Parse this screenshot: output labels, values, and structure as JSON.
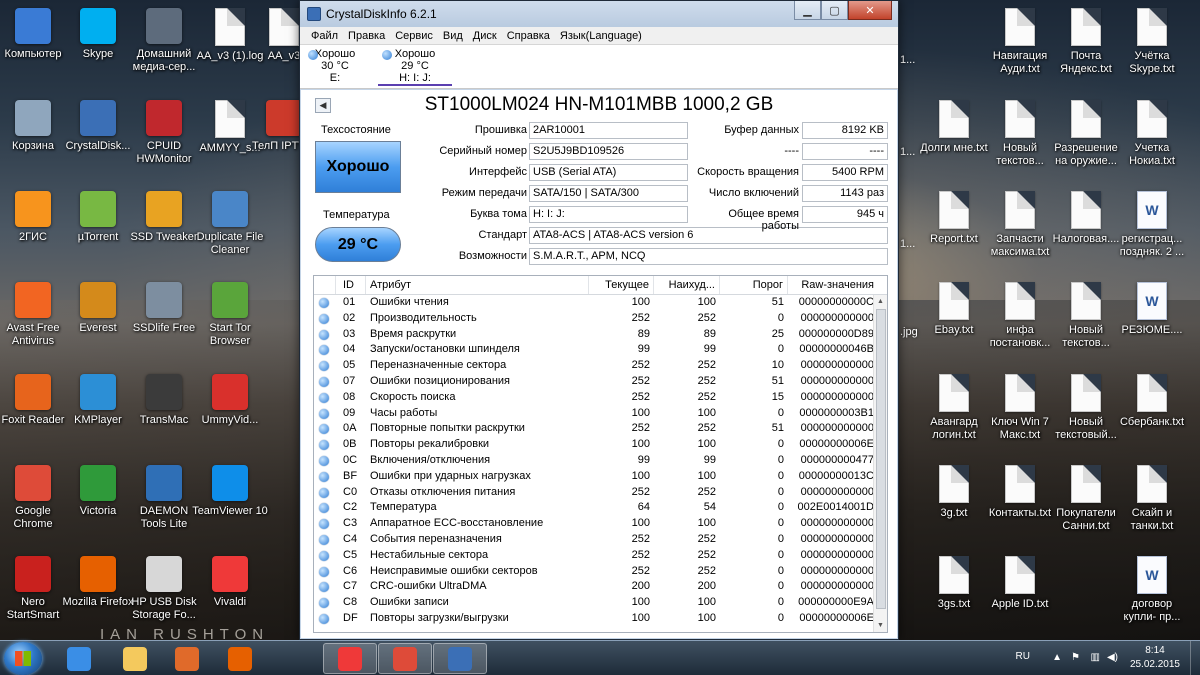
{
  "window": {
    "title": "CrystalDiskInfo 6.2.1",
    "menu": [
      "Файл",
      "Правка",
      "Сервис",
      "Вид",
      "Диск",
      "Справка",
      "Язык(Language)"
    ],
    "drives": [
      {
        "status": "Хорошо",
        "temp": "30 °C",
        "letters": "E:"
      },
      {
        "status": "Хорошо",
        "temp": "29 °C",
        "letters": "H: I: J:"
      }
    ],
    "model": "ST1000LM024 HN-M101MBB 1000,2 GB",
    "health_label": "Техсостояние",
    "health_value": "Хорошо",
    "temp_label": "Температура",
    "temp_value": "29 °C",
    "fields": {
      "firmware_label": "Прошивка",
      "firmware": "2AR10001",
      "serial_label": "Серийный номер",
      "serial": "S2U5J9BD109526",
      "interface_label": "Интерфейс",
      "interface": "USB (Serial ATA)",
      "transfer_label": "Режим передачи",
      "transfer": "SATA/150 | SATA/300",
      "letter_label": "Буква тома",
      "letter": "H: I: J:",
      "standard_label": "Стандарт",
      "standard": "ATA8-ACS | ATA8-ACS version 6",
      "features_label": "Возможности",
      "features": "S.M.A.R.T., APM, NCQ",
      "buffer_label": "Буфер данных",
      "buffer": "8192 KB",
      "blank_label": "----",
      "blank": "----",
      "rpm_label": "Скорость вращения",
      "rpm": "5400 RPM",
      "power_count_label": "Число включений",
      "power_count": "1143 раз",
      "power_hours_label": "Общее время работы",
      "power_hours": "945 ч"
    },
    "smart_headers": [
      "ID",
      "Атрибут",
      "Текущее",
      "Наихуд...",
      "Порог",
      "Raw-значения"
    ],
    "smart_rows": [
      [
        "01",
        "Ошибки чтения",
        "100",
        "100",
        "51",
        "00000000000C"
      ],
      [
        "02",
        "Производительность",
        "252",
        "252",
        "0",
        "000000000000"
      ],
      [
        "03",
        "Время раскрутки",
        "89",
        "89",
        "25",
        "000000000D89"
      ],
      [
        "04",
        "Запуски/остановки шпинделя",
        "99",
        "99",
        "0",
        "00000000046B"
      ],
      [
        "05",
        "Переназначенные сектора",
        "252",
        "252",
        "10",
        "000000000000"
      ],
      [
        "07",
        "Ошибки позиционирования",
        "252",
        "252",
        "51",
        "000000000000"
      ],
      [
        "08",
        "Скорость поиска",
        "252",
        "252",
        "15",
        "000000000000"
      ],
      [
        "09",
        "Часы работы",
        "100",
        "100",
        "0",
        "0000000003B1"
      ],
      [
        "0A",
        "Повторные попытки раскрутки",
        "252",
        "252",
        "51",
        "000000000000"
      ],
      [
        "0B",
        "Повторы рекалибровки",
        "100",
        "100",
        "0",
        "00000000006E"
      ],
      [
        "0C",
        "Включения/отключения",
        "99",
        "99",
        "0",
        "000000000477"
      ],
      [
        "BF",
        "Ошибки при ударных нагрузках",
        "100",
        "100",
        "0",
        "00000000013C"
      ],
      [
        "C0",
        "Отказы отключения питания",
        "252",
        "252",
        "0",
        "000000000000"
      ],
      [
        "C2",
        "Температура",
        "64",
        "54",
        "0",
        "002E0014001D"
      ],
      [
        "C3",
        "Аппаратное ECC-восстановление",
        "100",
        "100",
        "0",
        "000000000000"
      ],
      [
        "C4",
        "События переназначения",
        "252",
        "252",
        "0",
        "000000000000"
      ],
      [
        "C5",
        "Нестабильные сектора",
        "252",
        "252",
        "0",
        "000000000000"
      ],
      [
        "C6",
        "Неисправимые ошибки секторов",
        "252",
        "252",
        "0",
        "000000000000"
      ],
      [
        "C7",
        "CRC-ошибки UltraDMA",
        "200",
        "200",
        "0",
        "000000000000"
      ],
      [
        "C8",
        "Ошибки записи",
        "100",
        "100",
        "0",
        "000000000E9A"
      ],
      [
        "DF",
        "Повторы загрузки/выгрузки",
        "100",
        "100",
        "0",
        "00000000006E"
      ]
    ]
  },
  "desktop_icons_left": [
    {
      "label": "Компьютер",
      "icon": "computer-icon",
      "color": "#3a7bd5"
    },
    {
      "label": "Skype",
      "icon": "skype-icon",
      "color": "#00aff0"
    },
    {
      "label": "Домашний медиа-сер...",
      "icon": "media-server-icon",
      "color": "#5d6b7c"
    },
    {
      "label": "AA_v3 (1).log",
      "icon": "document-icon",
      "color": "#ffffff"
    },
    {
      "label": "AA_v3",
      "icon": "document-icon",
      "color": "#ffffff"
    },
    {
      "label": "Корзина",
      "icon": "recycle-bin-icon",
      "color": "#8fa6bd"
    },
    {
      "label": "CrystalDisk...",
      "icon": "crystaldisk-icon",
      "color": "#3b6fb6"
    },
    {
      "label": "CPUID HWMonitor",
      "icon": "hwmonitor-icon",
      "color": "#c0282d"
    },
    {
      "label": "AMMYY_s...",
      "icon": "document-icon",
      "color": "#ffffff"
    },
    {
      "label": "ТелП IPTV P",
      "icon": "iptv-icon",
      "color": "#cc3a2b"
    },
    {
      "label": "2ГИС",
      "icon": "2gis-icon",
      "color": "#f7941d"
    },
    {
      "label": "µTorrent",
      "icon": "utorrent-icon",
      "color": "#78b843"
    },
    {
      "label": "SSD Tweaker",
      "icon": "ssd-tweaker-icon",
      "color": "#e8a322"
    },
    {
      "label": "Duplicate File Cleaner",
      "icon": "duplicate-cleaner-icon",
      "color": "#4a86c8"
    },
    {
      "label": "Avast Free Antivirus",
      "icon": "avast-icon",
      "color": "#f26522"
    },
    {
      "label": "Everest",
      "icon": "everest-icon",
      "color": "#d48a1b"
    },
    {
      "label": "SSDlife Free",
      "icon": "ssdlife-icon",
      "color": "#7d8ea0"
    },
    {
      "label": "Start Tor Browser",
      "icon": "tor-icon",
      "color": "#5aa53b"
    },
    {
      "label": "Foxit Reader",
      "icon": "foxit-icon",
      "color": "#e7641c"
    },
    {
      "label": "KMPlayer",
      "icon": "kmplayer-icon",
      "color": "#2c8fd6"
    },
    {
      "label": "TransMac",
      "icon": "transmac-icon",
      "color": "#3b3b3b"
    },
    {
      "label": "UmmyVid...",
      "icon": "ummy-icon",
      "color": "#d9302c"
    },
    {
      "label": "Google Chrome",
      "icon": "chrome-icon",
      "color": "#de4b39"
    },
    {
      "label": "Victoria",
      "icon": "victoria-icon",
      "color": "#2f9a3a"
    },
    {
      "label": "DAEMON Tools Lite",
      "icon": "daemon-tools-icon",
      "color": "#2f6fb6"
    },
    {
      "label": "TeamViewer 10",
      "icon": "teamviewer-icon",
      "color": "#0e8ee9"
    },
    {
      "label": "Nero StartSmart",
      "icon": "nero-icon",
      "color": "#c9211e"
    },
    {
      "label": "Mozilla Firefox",
      "icon": "firefox-icon",
      "color": "#e66000"
    },
    {
      "label": "HP USB Disk Storage Fo...",
      "icon": "hp-usb-icon",
      "color": "#d7d7d7"
    },
    {
      "label": "Vivaldi",
      "icon": "vivaldi-icon",
      "color": "#ef3939"
    }
  ],
  "desktop_icons_right": [
    {
      "label": "Навигация Ауди.txt",
      "icon": "document-icon"
    },
    {
      "label": "Почта Яндекс.txt",
      "icon": "document-icon"
    },
    {
      "label": "Учётка Skype.txt",
      "icon": "document-icon"
    },
    {
      "label": "Долги мне.txt",
      "icon": "document-icon"
    },
    {
      "label": "Новый текстов...",
      "icon": "document-icon"
    },
    {
      "label": "Разрешение на оружие...",
      "icon": "document-icon"
    },
    {
      "label": "Учетка Нокиа.txt",
      "icon": "document-icon"
    },
    {
      "label": "Report.txt",
      "icon": "document-icon"
    },
    {
      "label": "Запчасти максима.txt",
      "icon": "document-icon"
    },
    {
      "label": "Налоговая....",
      "icon": "document-icon"
    },
    {
      "label": "регистрац... поздняк. 2 ...",
      "icon": "word-document-icon"
    },
    {
      "label": "Ebay.txt",
      "icon": "document-icon"
    },
    {
      "label": "инфа постановк...",
      "icon": "document-icon"
    },
    {
      "label": "Новый текстов...",
      "icon": "document-icon"
    },
    {
      "label": "РЕЗЮМЕ....",
      "icon": "word-document-icon"
    },
    {
      "label": "Авангард логин.txt",
      "icon": "document-icon"
    },
    {
      "label": "Ключ Win 7 Макс.txt",
      "icon": "document-icon"
    },
    {
      "label": "Новый текстовый...",
      "icon": "document-icon"
    },
    {
      "label": "Сбербанк.txt",
      "icon": "document-icon"
    },
    {
      "label": "3g.txt",
      "icon": "document-icon"
    },
    {
      "label": "Контакты.txt",
      "icon": "document-icon"
    },
    {
      "label": "Покупатели Санни.txt",
      "icon": "document-icon"
    },
    {
      "label": "Скайп и танки.txt",
      "icon": "document-icon"
    },
    {
      "label": "3gs.txt",
      "icon": "document-icon"
    },
    {
      "label": "Apple ID.txt",
      "icon": "document-icon"
    },
    {
      "label": "договор купли- пр...",
      "icon": "word-document-icon"
    }
  ],
  "partial_labels": [
    ".jpg",
    "1...",
    "1...",
    "1..."
  ],
  "wallpaper_credit": "IAN RUSHTON",
  "taskbar": {
    "apps": [
      {
        "name": "explorer-taskbar",
        "icon": "folder-icon",
        "color": "#f4c95d"
      },
      {
        "name": "ie-taskbar",
        "icon": "ie-icon",
        "color": "#3a8ee6"
      },
      {
        "name": "media-taskbar",
        "icon": "media-player-icon",
        "color": "#e06a2a"
      },
      {
        "name": "firefox-taskbar",
        "icon": "firefox-icon",
        "color": "#e66000"
      },
      {
        "name": "vivaldi-taskbar",
        "icon": "vivaldi-icon",
        "color": "#ef3939"
      },
      {
        "name": "chrome-taskbar",
        "icon": "chrome-icon",
        "color": "#de4b39"
      },
      {
        "name": "crystaldisk-taskbar",
        "icon": "crystaldisk-icon",
        "color": "#3b6fb6"
      }
    ],
    "lang": "RU",
    "time": "8:14",
    "date": "25.02.2015"
  }
}
